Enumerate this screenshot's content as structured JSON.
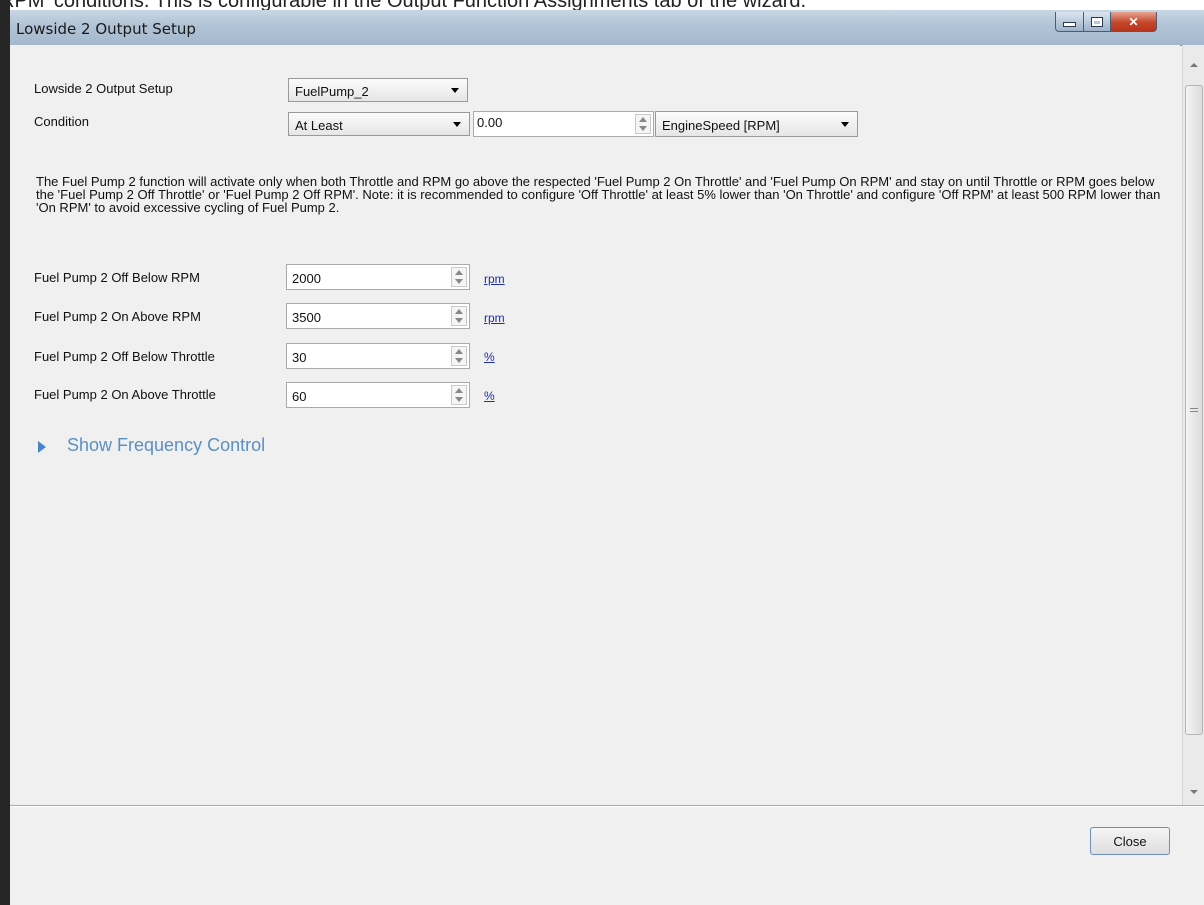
{
  "background_text": "RPM' conditions.  This is configurable in the Output Function Assignments tab of the wizard.",
  "window": {
    "title": "Lowside 2 Output Setup"
  },
  "setup": {
    "output_label": "Lowside 2 Output Setup",
    "output_value": "FuelPump_2",
    "condition_label": "Condition",
    "condition_value": "At Least",
    "condition_amount": "0.00",
    "condition_channel": "EngineSpeed [RPM]"
  },
  "description": "The Fuel Pump 2 function will activate only when both Throttle and RPM go above the respected 'Fuel Pump 2 On Throttle' and 'Fuel Pump On RPM' and stay on until Throttle or RPM goes below the 'Fuel Pump 2 Off Throttle' or 'Fuel Pump 2 Off RPM'.  Note: it is recommended to configure 'Off Throttle' at least 5% lower than 'On Throttle' and configure 'Off RPM' at least 500 RPM lower than 'On RPM' to avoid excessive cycling of Fuel Pump 2.",
  "fields": [
    {
      "label": "Fuel Pump 2 Off Below RPM",
      "value": "2000",
      "unit": "rpm"
    },
    {
      "label": "Fuel Pump 2 On Above RPM",
      "value": "3500",
      "unit": "rpm"
    },
    {
      "label": "Fuel Pump 2 Off Below Throttle",
      "value": "30",
      "unit": "%"
    },
    {
      "label": "Fuel Pump 2 On Above Throttle",
      "value": "60",
      "unit": "%"
    }
  ],
  "frequency_toggle": "Show Frequency Control",
  "close_label": "Close",
  "colors": {
    "link": "#1f2ea8",
    "expander": "#5c8fc0"
  }
}
